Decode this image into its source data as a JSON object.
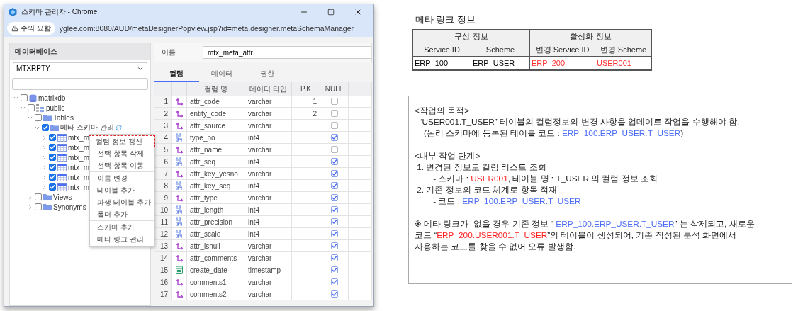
{
  "window": {
    "title": "스키마 관리자 - Chrome",
    "security_badge": "주의 요함",
    "url": "yglee.com:8080/AUD/metaDesignerPopview.jsp?id=meta.designer.metaSchemaManager"
  },
  "database_panel": {
    "title": "데이터베이스",
    "database": "MTXRPTY",
    "tree": [
      {
        "label": "matrixdb",
        "kind": "database",
        "checked": false,
        "expanded": true,
        "children": [
          {
            "label": "public",
            "kind": "schema",
            "checked": false,
            "expanded": true,
            "children": [
              {
                "label": "Tables",
                "kind": "folder",
                "checked": false,
                "expanded": true,
                "children": [
                  {
                    "label": "메타 스키마 관리",
                    "kind": "folder",
                    "checked": true,
                    "expanded": true,
                    "sync": true,
                    "children": [
                      {
                        "label": "mtx_m",
                        "kind": "table",
                        "checked": true,
                        "expanded": false
                      },
                      {
                        "label": "mtx_m",
                        "kind": "table",
                        "checked": true,
                        "expanded": false
                      },
                      {
                        "label": "mtx_m",
                        "kind": "table",
                        "checked": true,
                        "expanded": false
                      },
                      {
                        "label": "mtx_m",
                        "kind": "table",
                        "checked": true,
                        "expanded": false
                      },
                      {
                        "label": "mtx_m",
                        "kind": "table",
                        "checked": true,
                        "expanded": false
                      },
                      {
                        "label": "mtx_m",
                        "kind": "table",
                        "checked": true,
                        "expanded": false
                      }
                    ]
                  }
                ]
              },
              {
                "label": "Views",
                "kind": "folder",
                "checked": false,
                "expanded": false
              },
              {
                "label": "Synonyms",
                "kind": "folder",
                "checked": false,
                "expanded": false
              }
            ]
          }
        ]
      }
    ]
  },
  "context_menu": {
    "groups": [
      [
        {
          "label": "컬럼 정보 갱신",
          "highlighted": true
        },
        {
          "label": "선택 항목 삭제",
          "highlighted": false
        },
        {
          "label": "선택 항목 이동",
          "highlighted": false
        }
      ],
      [
        {
          "label": "이름 변경",
          "highlighted": false
        },
        {
          "label": "테이블 추가",
          "highlighted": false
        },
        {
          "label": "파생 테이블 추가",
          "highlighted": false
        },
        {
          "label": "폴더 추가",
          "highlighted": false
        }
      ],
      [
        {
          "label": "스키마 추가",
          "highlighted": false
        },
        {
          "label": "메타 링크 관리",
          "highlighted": false
        }
      ]
    ]
  },
  "detail": {
    "name_label": "이름",
    "name_value": "mtx_meta_attr",
    "tabs": [
      {
        "label": "컬럼",
        "selected": true
      },
      {
        "label": "데이터",
        "selected": false
      },
      {
        "label": "권한",
        "selected": false
      }
    ],
    "columns": [
      "컬럼 명",
      "데이터 타입",
      "P.K",
      "NULL"
    ],
    "rows": [
      {
        "no": "1",
        "kind": "text",
        "name": "attr_code",
        "type": "varchar",
        "pk": "1",
        "nullable": false
      },
      {
        "no": "2",
        "kind": "text",
        "name": "entity_code",
        "type": "varchar",
        "pk": "2",
        "nullable": false
      },
      {
        "no": "3",
        "kind": "text",
        "name": "attr_source",
        "type": "varchar",
        "nullable": false
      },
      {
        "no": "4",
        "kind": "number",
        "name": "type_no",
        "type": "int4",
        "nullable": true
      },
      {
        "no": "5",
        "kind": "text",
        "name": "attr_name",
        "type": "varchar",
        "nullable": false
      },
      {
        "no": "6",
        "kind": "number",
        "name": "attr_seq",
        "type": "int4",
        "nullable": true
      },
      {
        "no": "7",
        "kind": "text",
        "name": "attr_key_yesno",
        "type": "varchar",
        "nullable": true
      },
      {
        "no": "8",
        "kind": "number",
        "name": "attr_key_seq",
        "type": "int4",
        "nullable": true
      },
      {
        "no": "9",
        "kind": "text",
        "name": "attr_type",
        "type": "varchar",
        "nullable": true
      },
      {
        "no": "10",
        "kind": "number",
        "name": "attr_length",
        "type": "int4",
        "nullable": true
      },
      {
        "no": "11",
        "kind": "number",
        "name": "attr_precision",
        "type": "int4",
        "nullable": true
      },
      {
        "no": "12",
        "kind": "number",
        "name": "attr_scale",
        "type": "int4",
        "nullable": true
      },
      {
        "no": "13",
        "kind": "text",
        "name": "attr_isnull",
        "type": "varchar",
        "nullable": true
      },
      {
        "no": "14",
        "kind": "text",
        "name": "attr_comments",
        "type": "varchar",
        "nullable": true
      },
      {
        "no": "15",
        "kind": "date",
        "name": "create_date",
        "type": "timestamp",
        "nullable": true
      },
      {
        "no": "16",
        "kind": "text",
        "name": "comments1",
        "type": "varchar",
        "nullable": true
      },
      {
        "no": "17",
        "kind": "text",
        "name": "comments2",
        "type": "varchar",
        "nullable": true
      }
    ]
  },
  "meta_link": {
    "title": "메타 링크 정보",
    "groups": [
      "구성 정보",
      "활성화 정보"
    ],
    "columns": [
      "Service ID",
      "Scheme",
      "변경 Service ID",
      "변경 Scheme"
    ],
    "row": [
      {
        "text": "ERP_100",
        "color": "#000000"
      },
      {
        "text": "ERP_USER",
        "color": "#000000"
      },
      {
        "text": "ERP_200",
        "color": "#ff3030"
      },
      {
        "text": "USER001",
        "color": "#ff3030"
      }
    ]
  },
  "notes": {
    "paragraphs": [
      {
        "lines": [
          {
            "segments": [
              {
                "text": "<작업의 목적>"
              }
            ]
          },
          {
            "segments": [
              {
                "text": "  “USER001.T_USER” 테이블의 컬럼정보의 변경 사항을 업데이트 작업을 수행해야 함."
              }
            ]
          },
          {
            "segments": [
              {
                "text": "    (논리 스키마에 등록된 테이블 코드 : "
              },
              {
                "text": "ERP_100.ERP_USER.T_USER",
                "color": "#4a6cf7"
              },
              {
                "text": ")"
              }
            ]
          }
        ]
      },
      {
        "lines": [
          {
            "segments": [
              {
                "text": "<내부 작업 단계>"
              }
            ]
          },
          {
            "segments": [
              {
                "text": " 1. 변경된 정보로 컬럼 리스트 조회"
              }
            ]
          },
          {
            "segments": [
              {
                "text": "        - 스키마 : "
              },
              {
                "text": "USER001",
                "color": "#ff2020"
              },
              {
                "text": ", 테이블 명 : T_USER 의 컬럼 정보 조회"
              }
            ]
          },
          {
            "segments": [
              {
                "text": " 2. 기존 정보의 코드 체계로 항목 적재"
              }
            ]
          },
          {
            "segments": [
              {
                "text": "        - 코드 : "
              },
              {
                "text": "ERP_100.ERP_USER.T_USER",
                "color": "#4a6cf7"
              }
            ]
          }
        ]
      },
      {
        "lines": [
          {
            "segments": [
              {
                "text": "※ 메타 링크가  없을 경우 기존 정보 “ "
              },
              {
                "text": "ERP_100.ERP_USER.T_USER",
                "color": "#4a6cf7"
              },
              {
                "text": "” 는 삭제되고, 새로운"
              }
            ]
          },
          {
            "segments": [
              {
                "text": "코드 “"
              },
              {
                "text": "ERP_200.USER001.T_USER",
                "color": "#ff2020"
              },
              {
                "text": "”의 테이블이 생성되어, 기존 작성된 분석 화면에서"
              }
            ]
          },
          {
            "segments": [
              {
                "text": "사용하는 코드를 찾을 수 없어 오류 발생함."
              }
            ]
          }
        ]
      }
    ]
  }
}
